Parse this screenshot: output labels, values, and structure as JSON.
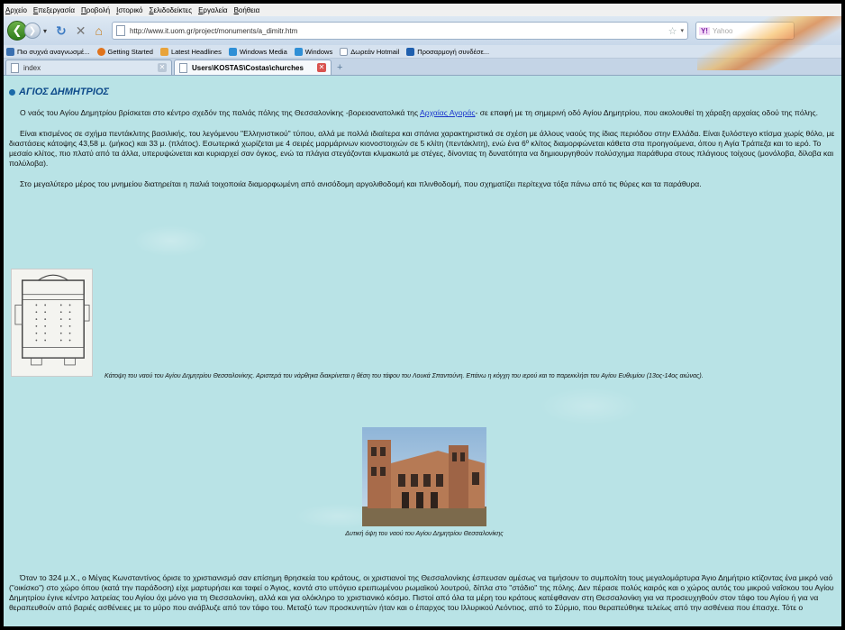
{
  "menu": [
    "Αρχείο",
    "Επεξεργασία",
    "Προβολή",
    "Ιστορικό",
    "Σελιδοδείκτες",
    "Εργαλεία",
    "Βοήθεια"
  ],
  "nav": {
    "url": "http://www.it.uom.gr/project/monuments/a_dimitr.htm",
    "search_placeholder": "Yahoo",
    "search_engine_badge": "Y!"
  },
  "bookmarks": [
    {
      "label": "Πιο συχνά αναγνωσμέ...",
      "color": "#3a6fb0"
    },
    {
      "label": "Getting Started",
      "color": "#e0731c"
    },
    {
      "label": "Latest Headlines",
      "color": "#e8a33a"
    },
    {
      "label": "Windows Media",
      "color": "#2f8fd6"
    },
    {
      "label": "Windows",
      "color": "#2f8fd6"
    },
    {
      "label": "Δωρεάν Hotmail",
      "color": "#ffffff"
    },
    {
      "label": "Προσαρμογή συνδέσε...",
      "color": "#1f5fae"
    }
  ],
  "tabs": {
    "inactive_label": "index",
    "active_label": "Users\\KOSTAS\\Costas\\churches"
  },
  "page": {
    "title": "ΑΓΙΟΣ ΔΗΜΗΤΡΙΟΣ",
    "p1_before_link": "Ο ναός του Αγίου Δημητρίου βρίσκεται στο κέντρο σχεδόν της παλιάς πόλης της Θεσσαλονίκης -βορειοανατολικά της ",
    "p1_link": "Αρχαίας Αγοράς",
    "p1_after_link": "- σε επαφή με τη σημερινή οδό Αγίου Δημητρίου, που ακολουθεί τη χάραξη αρχαίας οδού της πόλης.",
    "p2": "Είναι κτισμένος σε σχήμα πεντάκλιτης βασιλικής, του λεγόμενου \"Ελληνιστικού\" τύπου, αλλά με πολλά ιδιαίτερα και σπάνια χαρακτηριστικά σε σχέση με άλλους ναούς της ίδιας περιόδου στην Ελλάδα. Είναι ξυλόστεγο κτίσμα χωρίς θόλο, με διαστάσεις κάτοψης 43,58 μ. (μήκος) και 33 μ. (πλάτος). Εσωτερικά χωρίζεται με 4 σειρές μαρμάρινων κιονοστοιχιών σε 5 κλίτη (πεντάκλιτη), ενώ ένα 6º κλίτος διαμορφώνεται κάθετα στα προηγούμενα, όπου η Αγία Τράπεζα και το ιερό. Το μεσαίο κλίτος, πιο πλατύ από τα άλλα, υπερυψώνεται και κυριαρχεί σαν όγκος, ενώ τα πλάγια στεγάζονται κλιμακωτά με στέγες, δίνοντας τη δυνατότητα να δημιουργηθούν πολύσχημα παράθυρα στους πλάγιους τοίχους (μονόλοβα, δίλοβα και πολύλοβα).",
    "p3": "Στο μεγαλύτερο μέρος του μνημείου διατηρείται η παλιά τοιχοποιία διαμορφωμένη από ανισόδομη αργολιθοδομή και πλινθοδομή, που σχηματίζει περίτεχνα τόξα πάνω από τις θύρες και τα παράθυρα.",
    "caption1": "Κάτοψη του ναού του Αγίου Δημητρίου Θεσσαλονίκης. Αριστερά του νάρθηκα διακρίνεται η θέση του τάφου του Λουκά Σπαντούνη. Επάνω η κόγχη του ιερού και το παρεκκλήσι του Αγίου Ευθυμίου (13ος-14ος αιώνας).",
    "caption2": "Δυτική όψη του ναού του Αγίου Δημητρίου Θεσσαλονίκης",
    "p4": "Όταν το 324 μ.Χ., ο Μέγας Κωνσταντίνος όρισε το χριστιανισμό σαν επίσημη θρησκεία του κράτους, οι χριστιανοί της Θεσσαλονίκης έσπευσαν αμέσως να τιμήσουν το συμπολίτη τους μεγαλομάρτυρα Άγιο Δημήτριο κτίζοντας ένα μικρό ναό (\"οικίσκο\") στο χώρο όπου (κατά την παράδοση) είχε μαρτυρήσει και ταφεί ο Άγιος, κοντά στο υπόγειο ερειπωμένου ρωμαϊκού λουτρού, δίπλα στο \"στάδιο\" της πόλης. Δεν πέρασε πολύς καιρός και ο χώρος αυτός του μικρού ναΐσκου του Αγίου Δημητρίου έγινε κέντρο λατρείας του Αγίου όχι μόνο για τη Θεσσαλονίκη, αλλά και για ολόκληρο το χριστιανικό κόσμο. Πιστοί από όλα τα μέρη του κράτους κατέφθαναν στη Θεσσαλονίκη για να προσευχηθούν στον τάφο του Αγίου ή για να θεραπευθούν από βαριές ασθένειες με το μύρο που ανάβλυζε από τον τάφο του. Μεταξύ των προσκυνητών ήταν και ο έπαρχος του Ιλλυρικού Λεόντιος, από το Σύρμιο, που θεραπεύθηκε τελείως από την ασθένεια που έπασχε. Τότε ο"
  }
}
